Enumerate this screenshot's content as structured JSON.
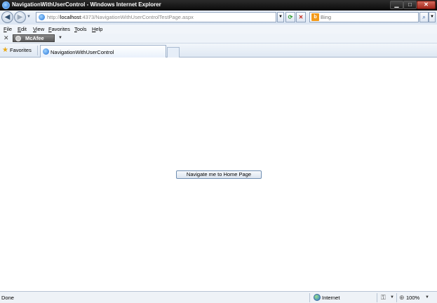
{
  "window": {
    "title": "NavigationWithUserControl - Windows Internet Explorer",
    "buttons": {
      "minimize": "▁",
      "maximize": "□",
      "close": "✕"
    }
  },
  "address_bar": {
    "url_prefix": "http://",
    "url_host": "localhost",
    "url_rest": ":4373/NavigationWithUserControlTestPage.aspx"
  },
  "search": {
    "placeholder": "Bing",
    "engine_icon": "b"
  },
  "menu": {
    "items": [
      {
        "label": "File",
        "underline": "F",
        "rest": "ile"
      },
      {
        "label": "Edit",
        "underline": "E",
        "rest": "dit"
      },
      {
        "label": "View",
        "underline": "V",
        "rest": "iew"
      },
      {
        "label": "Favorites",
        "underline": "F",
        "rest": "avorites"
      },
      {
        "label": "Tools",
        "underline": "T",
        "rest": "ools"
      },
      {
        "label": "Help",
        "underline": "H",
        "rest": "elp"
      }
    ]
  },
  "toolbar": {
    "close": "✕",
    "mcafee_label": "McAfee"
  },
  "favorites": {
    "label": "Favorites"
  },
  "tabs": [
    {
      "label": "NavigationWithUserControl"
    }
  ],
  "content": {
    "button_label": "Navigate me to Home Page"
  },
  "status": {
    "text": "Done",
    "zone": "Internet",
    "zoom": "100%"
  }
}
